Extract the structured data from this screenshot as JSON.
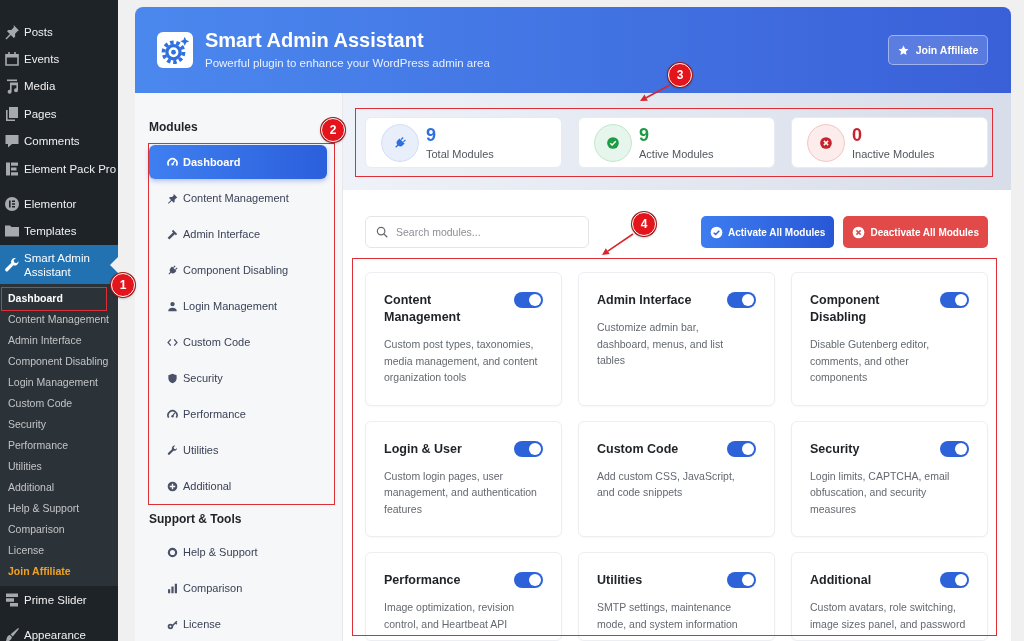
{
  "wp_menu": {
    "groups": [
      {
        "items": [
          {
            "label": "Posts",
            "current": false
          },
          {
            "label": "Events",
            "current": false
          },
          {
            "label": "Media",
            "current": false
          },
          {
            "label": "Pages",
            "current": false
          },
          {
            "label": "Comments",
            "current": false
          },
          {
            "label": "Element Pack Pro",
            "current": false
          }
        ]
      },
      {
        "items": [
          {
            "label": "Elementor",
            "current": false
          },
          {
            "label": "Templates",
            "current": false
          },
          {
            "label": "Smart Admin Assistant",
            "current": true,
            "submenu": [
              {
                "label": "Dashboard",
                "selected": true,
                "kind": "link",
                "annotation": {
                  "number": "1",
                  "arrow": false
                }
              },
              {
                "label": "Content Management",
                "selected": false,
                "kind": "link"
              },
              {
                "label": "Admin Interface",
                "selected": false,
                "kind": "link"
              },
              {
                "label": "Component Disabling",
                "selected": false,
                "kind": "link"
              },
              {
                "label": "Login Management",
                "selected": false,
                "kind": "link"
              },
              {
                "label": "Custom Code",
                "selected": false,
                "kind": "link"
              },
              {
                "label": "Security",
                "selected": false,
                "kind": "link"
              },
              {
                "label": "Performance",
                "selected": false,
                "kind": "link"
              },
              {
                "label": "Utilities",
                "selected": false,
                "kind": "link"
              },
              {
                "label": "Additional",
                "selected": false,
                "kind": "link"
              },
              {
                "label": "Help & Support",
                "selected": false,
                "kind": "link"
              },
              {
                "label": "Comparison",
                "selected": false,
                "kind": "link"
              },
              {
                "label": "License",
                "selected": false,
                "kind": "link"
              },
              {
                "label": "Join Affiliate",
                "selected": false,
                "kind": "promo"
              }
            ]
          },
          {
            "label": "Prime Slider",
            "current": false
          }
        ]
      },
      {
        "items": [
          {
            "label": "Appearance",
            "current": false
          }
        ]
      }
    ]
  },
  "header": {
    "title": "Smart Admin Assistant",
    "subtitle": "Powerful plugin to enhance your WordPress admin area",
    "button": {
      "label": "Join Affiliate"
    }
  },
  "module_nav": {
    "sections": [
      {
        "heading": "Modules",
        "annotation": {
          "number": "2",
          "arrow": false
        },
        "items": [
          {
            "label": "Dashboard",
            "selected": true
          },
          {
            "label": "Content Management",
            "selected": false
          },
          {
            "label": "Admin Interface",
            "selected": false
          },
          {
            "label": "Component Disabling",
            "selected": false
          },
          {
            "label": "Login Management",
            "selected": false
          },
          {
            "label": "Custom Code",
            "selected": false
          },
          {
            "label": "Security",
            "selected": false
          },
          {
            "label": "Performance",
            "selected": false
          },
          {
            "label": "Utilities",
            "selected": false
          },
          {
            "label": "Additional",
            "selected": false
          }
        ]
      },
      {
        "heading": "Support & Tools",
        "items": [
          {
            "label": "Help & Support",
            "selected": false
          },
          {
            "label": "Comparison",
            "selected": false
          },
          {
            "label": "License",
            "selected": false
          }
        ]
      }
    ]
  },
  "stats": {
    "annotation": {
      "number": "3",
      "arrow": true
    },
    "items": [
      {
        "kind": "total",
        "value": "9",
        "label": "Total Modules"
      },
      {
        "kind": "active",
        "value": "9",
        "label": "Active Modules"
      },
      {
        "kind": "inactive",
        "value": "0",
        "label": "Inactive Modules"
      }
    ]
  },
  "toolbar": {
    "search": {
      "placeholder": "Search modules..."
    },
    "buttons": [
      {
        "kind": "activate",
        "label": "Activate All Modules"
      },
      {
        "kind": "deactivate",
        "label": "Deactivate All Modules"
      }
    ]
  },
  "modules": {
    "annotation": {
      "number": "4",
      "arrow": true
    },
    "cards": [
      {
        "title": "Content Management",
        "description": "Custom post types, taxonomies, media management, and content organization tools",
        "on": true
      },
      {
        "title": "Admin Interface",
        "description": "Customize admin bar, dashboard, menus, and list tables",
        "on": true
      },
      {
        "title": "Component Disabling",
        "description": "Disable Gutenberg editor, comments, and other components",
        "on": true
      },
      {
        "title": "Login & User",
        "description": "Custom login pages, user management, and authentication features",
        "on": true
      },
      {
        "title": "Custom Code",
        "description": "Add custom CSS, JavaScript, and code snippets",
        "on": true
      },
      {
        "title": "Security",
        "description": "Login limits, CAPTCHA, email obfuscation, and security measures",
        "on": true
      },
      {
        "title": "Performance",
        "description": "Image optimization, revision control, and Heartbeat API",
        "on": true
      },
      {
        "title": "Utilities",
        "description": "SMTP settings, maintenance mode, and system information",
        "on": true
      },
      {
        "title": "Additional",
        "description": "Custom avatars, role switching, image sizes panel, and password",
        "on": true
      }
    ]
  }
}
